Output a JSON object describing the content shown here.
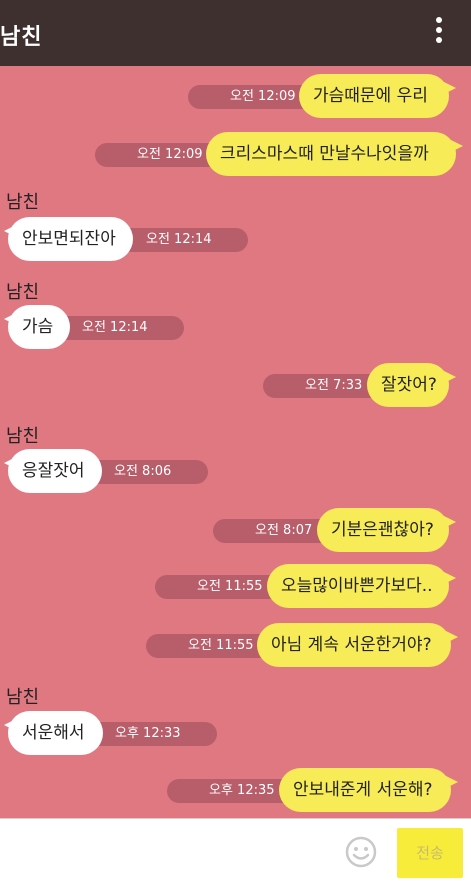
{
  "header": {
    "title": "남친"
  },
  "messages": [
    {
      "id": 0,
      "text": "가슴때문에 우리",
      "time": "오전 12:09"
    },
    {
      "id": 1,
      "text": "크리스마스때 만날수나잇을까",
      "time": "오전 12:09"
    },
    {
      "id": 2,
      "sender": "남친",
      "text": "안보면되잔아",
      "time": "오전 12:14"
    },
    {
      "id": 3,
      "sender": "남친",
      "text": "가슴",
      "time": "오전 12:14"
    },
    {
      "id": 4,
      "text": "잘잣어?",
      "time": "오전 7:33"
    },
    {
      "id": 5,
      "sender": "남친",
      "text": "응잘잣어",
      "time": "오전 8:06"
    },
    {
      "id": 6,
      "text": "기분은괜찮아?",
      "time": "오전 8:07"
    },
    {
      "id": 7,
      "text": "오늘많이바쁜가보다..",
      "time": "오전 11:55"
    },
    {
      "id": 8,
      "text": "아님 계속 서운한거야?",
      "time": "오전 11:55"
    },
    {
      "id": 9,
      "sender": "남친",
      "text": "서운해서",
      "time": "오후 12:33"
    },
    {
      "id": 10,
      "text": "안보내준게 서운해?",
      "time": "오후 12:35"
    }
  ],
  "footer": {
    "send_label": "전송",
    "emoji_icon": "smiley-face-icon"
  },
  "colors": {
    "background": "#e07882",
    "header": "#3f3030",
    "my_bubble": "#f7ec58",
    "their_bubble": "#ffffff",
    "timestamp_pill": "#b85d6a",
    "send_button": "#f7ec3a"
  }
}
